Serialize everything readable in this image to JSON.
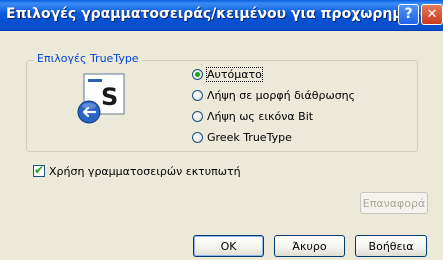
{
  "window": {
    "title": "Επιλογές γραμματοσειράς/κειμένου για προχωρημένους",
    "help_button": "?",
    "close_button": "✕"
  },
  "truetype_group": {
    "legend": "Επιλογές TrueType",
    "icon": "font-substitution-icon",
    "options": [
      {
        "label": "Αυτόματο",
        "selected": true
      },
      {
        "label": "Λήψη σε μορφή διάθρωσης",
        "selected": false
      },
      {
        "label": "Λήψη ως εικόνα Bit",
        "selected": false
      },
      {
        "label": "Greek TrueType",
        "selected": false
      }
    ]
  },
  "printer_fonts": {
    "label": "Χρήση γραμματοσειρών εκτυπωτή",
    "checked": true
  },
  "buttons": {
    "reset": "Επαναφορά",
    "ok": "OK",
    "cancel": "Άκυρο",
    "help": "Βοήθεια"
  },
  "colors": {
    "title_bar": "#0858dc",
    "legend_text": "#0046d5",
    "check_mark": "#21a121",
    "dialog_bg": "#ece9d8"
  }
}
